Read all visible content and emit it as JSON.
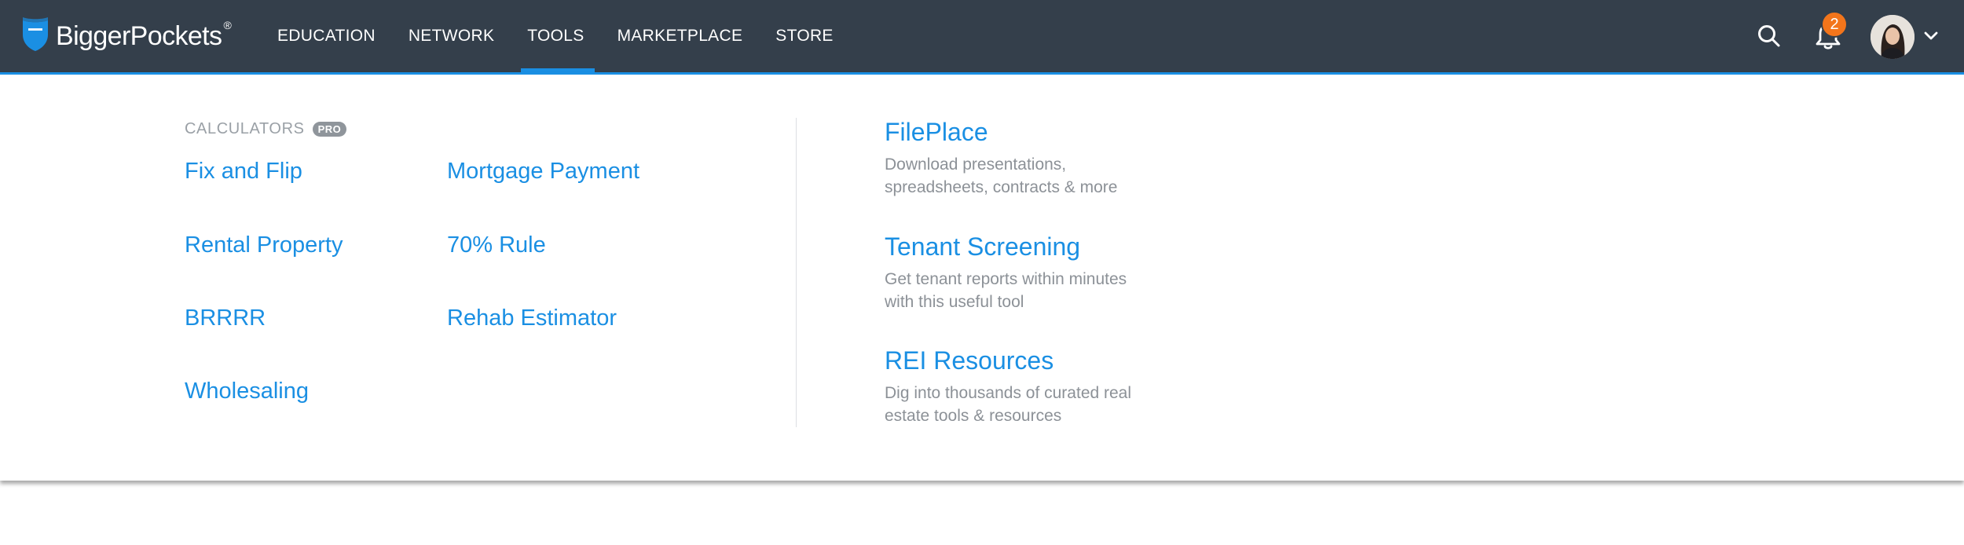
{
  "brand": {
    "name": "BiggerPockets",
    "registered": "®"
  },
  "nav": {
    "items": [
      {
        "label": "EDUCATION"
      },
      {
        "label": "NETWORK"
      },
      {
        "label": "TOOLS"
      },
      {
        "label": "MARKETPLACE"
      },
      {
        "label": "STORE"
      }
    ],
    "active": "TOOLS"
  },
  "header": {
    "notification_count": "2",
    "icons": [
      "search-icon",
      "bell-icon",
      "avatar",
      "chevron-down-icon"
    ]
  },
  "menu": {
    "calculators": {
      "label": "CALCULATORS",
      "badge": "PRO",
      "left": [
        "Fix and Flip",
        "Rental Property",
        "BRRRR",
        "Wholesaling"
      ],
      "right": [
        "Mortgage Payment",
        "70% Rule",
        "Rehab Estimator"
      ]
    },
    "tools": [
      {
        "title": "FilePlace",
        "desc1": "Download presentations,",
        "desc2": "spreadsheets, contracts & more"
      },
      {
        "title": "Tenant Screening",
        "desc1": "Get tenant reports within minutes",
        "desc2": "with this useful tool"
      },
      {
        "title": "REI Resources",
        "desc1": "Dig into thousands of curated real",
        "desc2": "estate tools & resources"
      }
    ]
  },
  "colors": {
    "nav_bg": "#343f4b",
    "accent": "#1a8fe3",
    "badge": "#f3751b"
  }
}
